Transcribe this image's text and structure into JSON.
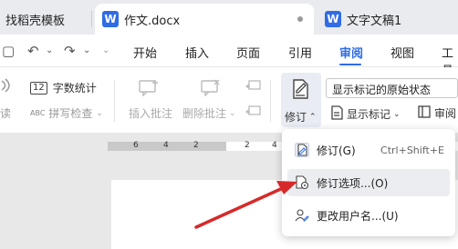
{
  "tabs": {
    "left": {
      "label": "找稻壳模板"
    },
    "active": {
      "label": "作文.docx",
      "icon": "W"
    },
    "right": {
      "label": "文字文稿1",
      "icon": "W"
    }
  },
  "menu": {
    "items": [
      "开始",
      "插入",
      "页面",
      "引用",
      "审阅",
      "视图",
      "工具"
    ],
    "active": "审阅"
  },
  "toolbar": {
    "read": "读",
    "word_count": "字数统计",
    "spell_check": "拼写检查",
    "insert_comment": "插入批注",
    "delete_comment": "删除批注",
    "revise": "修订",
    "display_mode_value": "显示标记的原始状态",
    "show_markup": "显示标记",
    "review": "审阅"
  },
  "ruler": {
    "ticks": [
      "6",
      "4",
      "2",
      "2",
      "4",
      "6",
      "8"
    ]
  },
  "dropdown": {
    "items": [
      {
        "label": "修订(G)",
        "shortcut": "Ctrl+Shift+E"
      },
      {
        "label": "修订选项...(O)"
      },
      {
        "label": "更改用户名...(U)"
      }
    ]
  },
  "colors": {
    "accent": "#2f6ce5",
    "arrow": "#d62a2a"
  }
}
